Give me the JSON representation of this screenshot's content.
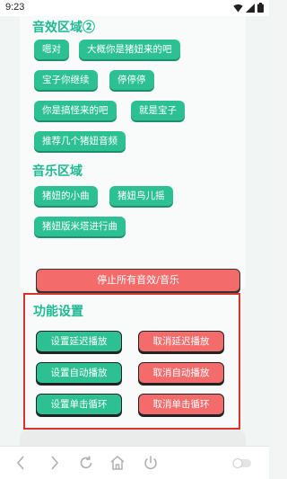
{
  "status": {
    "time": "9:23"
  },
  "sections": {
    "sound": {
      "title": "音效区域②",
      "chips": [
        "嗯对",
        "大概你是猪妞来的吧",
        "宝子你继续",
        "停停停",
        "你是搞怪来的吧",
        "就是宝子",
        "推荐几个猪妞音频"
      ]
    },
    "music": {
      "title": "音乐区域",
      "chips": [
        "猪妞的小曲",
        "猪妞鸟儿摇",
        "猪妞版米塔进行曲"
      ]
    },
    "stop_label": "停止所有音效/音乐",
    "function": {
      "title": "功能设置",
      "buttons": [
        {
          "set": "设置延迟播放",
          "cancel": "取消延迟播放"
        },
        {
          "set": "设置自动播放",
          "cancel": "取消自动播放"
        },
        {
          "set": "设置单击循环",
          "cancel": "取消单击循环"
        }
      ]
    }
  },
  "colors": {
    "accent": "#2dc092",
    "danger": "#f36b6b",
    "highlight_border": "#d9342b"
  },
  "navbar": [
    "back-icon",
    "forward-icon",
    "refresh-icon",
    "home-icon",
    "power-icon",
    "toggle-icon"
  ]
}
